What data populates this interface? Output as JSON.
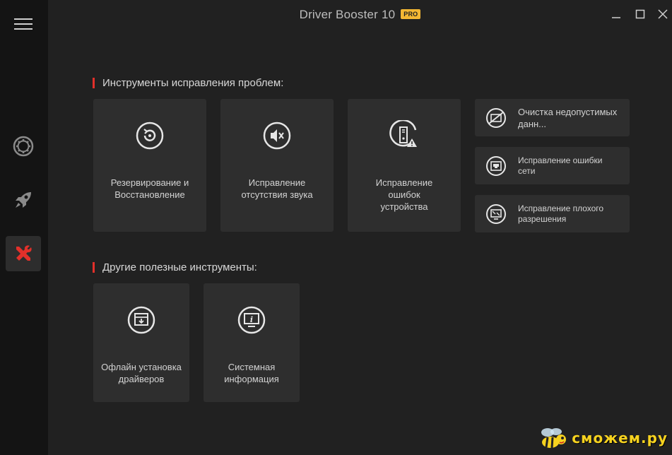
{
  "app": {
    "title": "Driver Booster 10",
    "badge": "PRO"
  },
  "sidebar": {
    "items": [
      {
        "name": "scan",
        "icon": "gear-icon"
      },
      {
        "name": "boost",
        "icon": "rocket-icon"
      },
      {
        "name": "toolbox",
        "icon": "tools-icon",
        "active": true
      }
    ]
  },
  "sections": {
    "fix_title": "Инструменты исправления проблем:",
    "other_title": "Другие полезные инструменты:"
  },
  "fix_tools": [
    {
      "label": "Резервирование и Восстановление",
      "icon": "backup-restore-icon"
    },
    {
      "label": "Исправление отсутствия звука",
      "icon": "sound-mute-icon"
    },
    {
      "label": "Исправление ошибок устройства",
      "icon": "device-error-icon"
    }
  ],
  "fix_tools_small": [
    {
      "label": "Очистка недопустимых данн...",
      "icon": "clean-invalid-data-icon"
    },
    {
      "label": "Исправление ошибки сети",
      "icon": "network-fix-icon"
    },
    {
      "label": "Исправление плохого разрешения",
      "icon": "resolution-fix-icon"
    }
  ],
  "other_tools": [
    {
      "label": "Офлайн установка драйверов",
      "icon": "offline-install-icon"
    },
    {
      "label": "Системная информация",
      "icon": "system-info-icon"
    }
  ],
  "watermark": {
    "text": "сможем.ру"
  },
  "colors": {
    "accent": "#e2302a",
    "pro_badge": "#f3b733",
    "card_bg": "#2e2e2e",
    "sidebar_bg": "#141414"
  }
}
